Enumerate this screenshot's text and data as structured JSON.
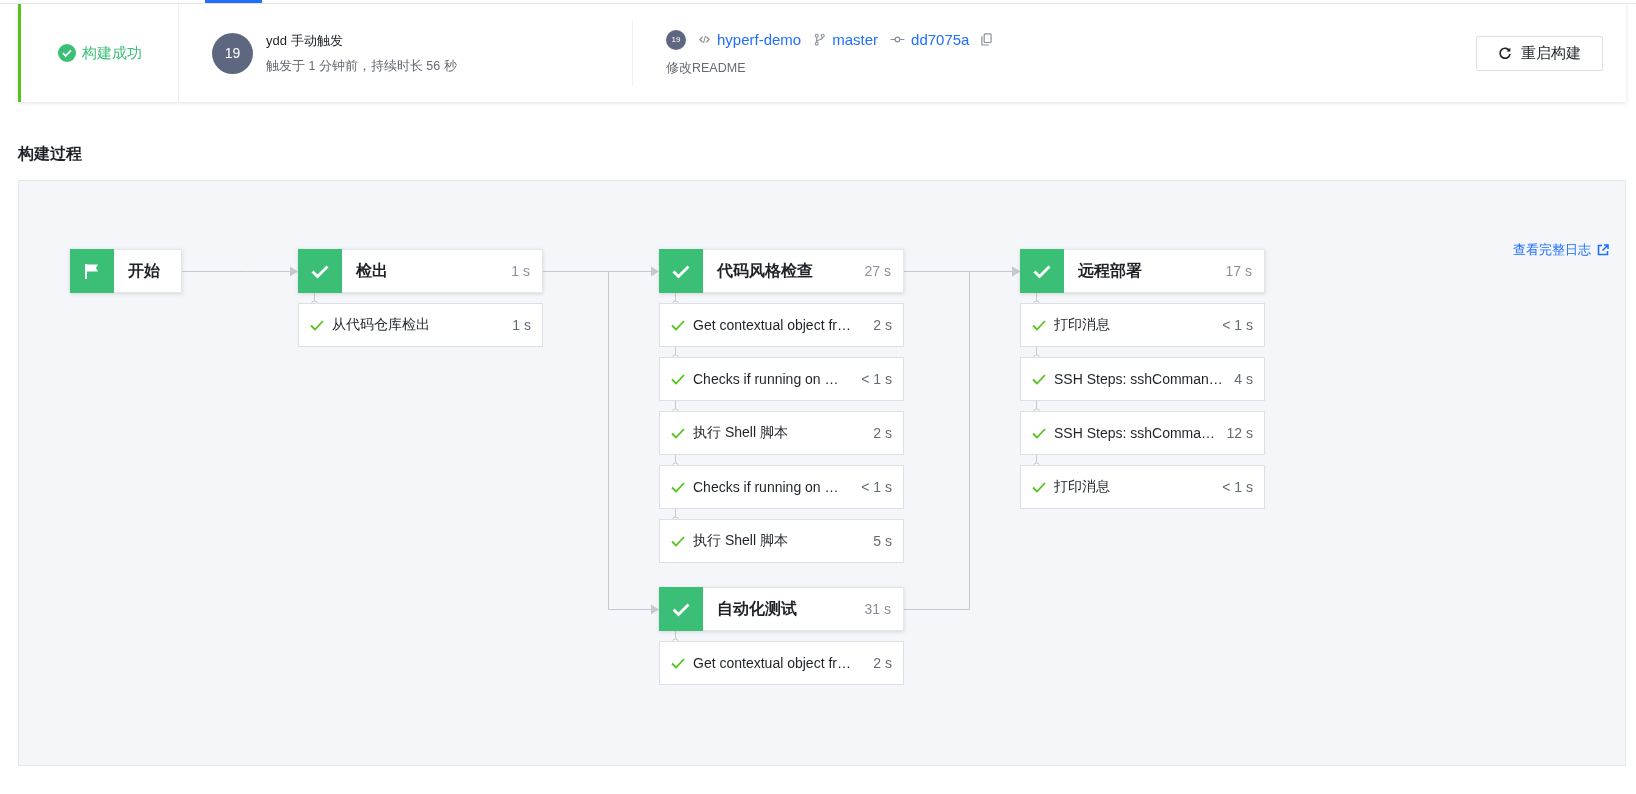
{
  "tab_indicator": {
    "selected": true
  },
  "build": {
    "status": {
      "text": "构建成功",
      "succeeded": true
    },
    "trigger": {
      "avatar": "19",
      "title": "ydd 手动触发",
      "detail": "触发于 1 分钟前，持续时长 56 秒"
    },
    "commit": {
      "avatar": "19",
      "repo": "hyperf-demo",
      "branch": "master",
      "hash": "dd7075a",
      "message": "修改README"
    },
    "restart_button": "重启构建"
  },
  "section_title": "构建过程",
  "log_link": "查看完整日志",
  "pipeline": {
    "columns": [
      {
        "stages": [
          {
            "kind": "start",
            "name": "开始",
            "passed": true
          }
        ]
      },
      {
        "stages": [
          {
            "kind": "stage",
            "name": "检出",
            "passed": true,
            "duration": "1 s",
            "steps": [
              {
                "name": "从代码仓库检出",
                "duration": "1 s",
                "passed": true
              }
            ]
          }
        ]
      },
      {
        "stages": [
          {
            "kind": "stage",
            "name": "代码风格检查",
            "passed": true,
            "duration": "27 s",
            "steps": [
              {
                "name": "Get contextual object fr…",
                "duration": "2 s",
                "passed": true
              },
              {
                "name": "Checks if running on …",
                "duration": "< 1 s",
                "passed": true
              },
              {
                "name": "执行 Shell 脚本",
                "duration": "2 s",
                "passed": true
              },
              {
                "name": "Checks if running on …",
                "duration": "< 1 s",
                "passed": true
              },
              {
                "name": "执行 Shell 脚本",
                "duration": "5 s",
                "passed": true
              }
            ]
          },
          {
            "kind": "stage",
            "name": "自动化测试",
            "passed": true,
            "duration": "31 s",
            "steps": [
              {
                "name": "Get contextual object fr…",
                "duration": "2 s",
                "passed": true
              }
            ]
          }
        ]
      },
      {
        "stages": [
          {
            "kind": "stage",
            "name": "远程部署",
            "passed": true,
            "duration": "17 s",
            "steps": [
              {
                "name": "打印消息",
                "duration": "< 1 s",
                "passed": true
              },
              {
                "name": "SSH Steps: sshComman…",
                "duration": "4 s",
                "passed": true
              },
              {
                "name": "SSH Steps: sshComma…",
                "duration": "12 s",
                "passed": true
              },
              {
                "name": "打印消息",
                "duration": "< 1 s",
                "passed": true
              }
            ]
          }
        ]
      }
    ]
  }
}
